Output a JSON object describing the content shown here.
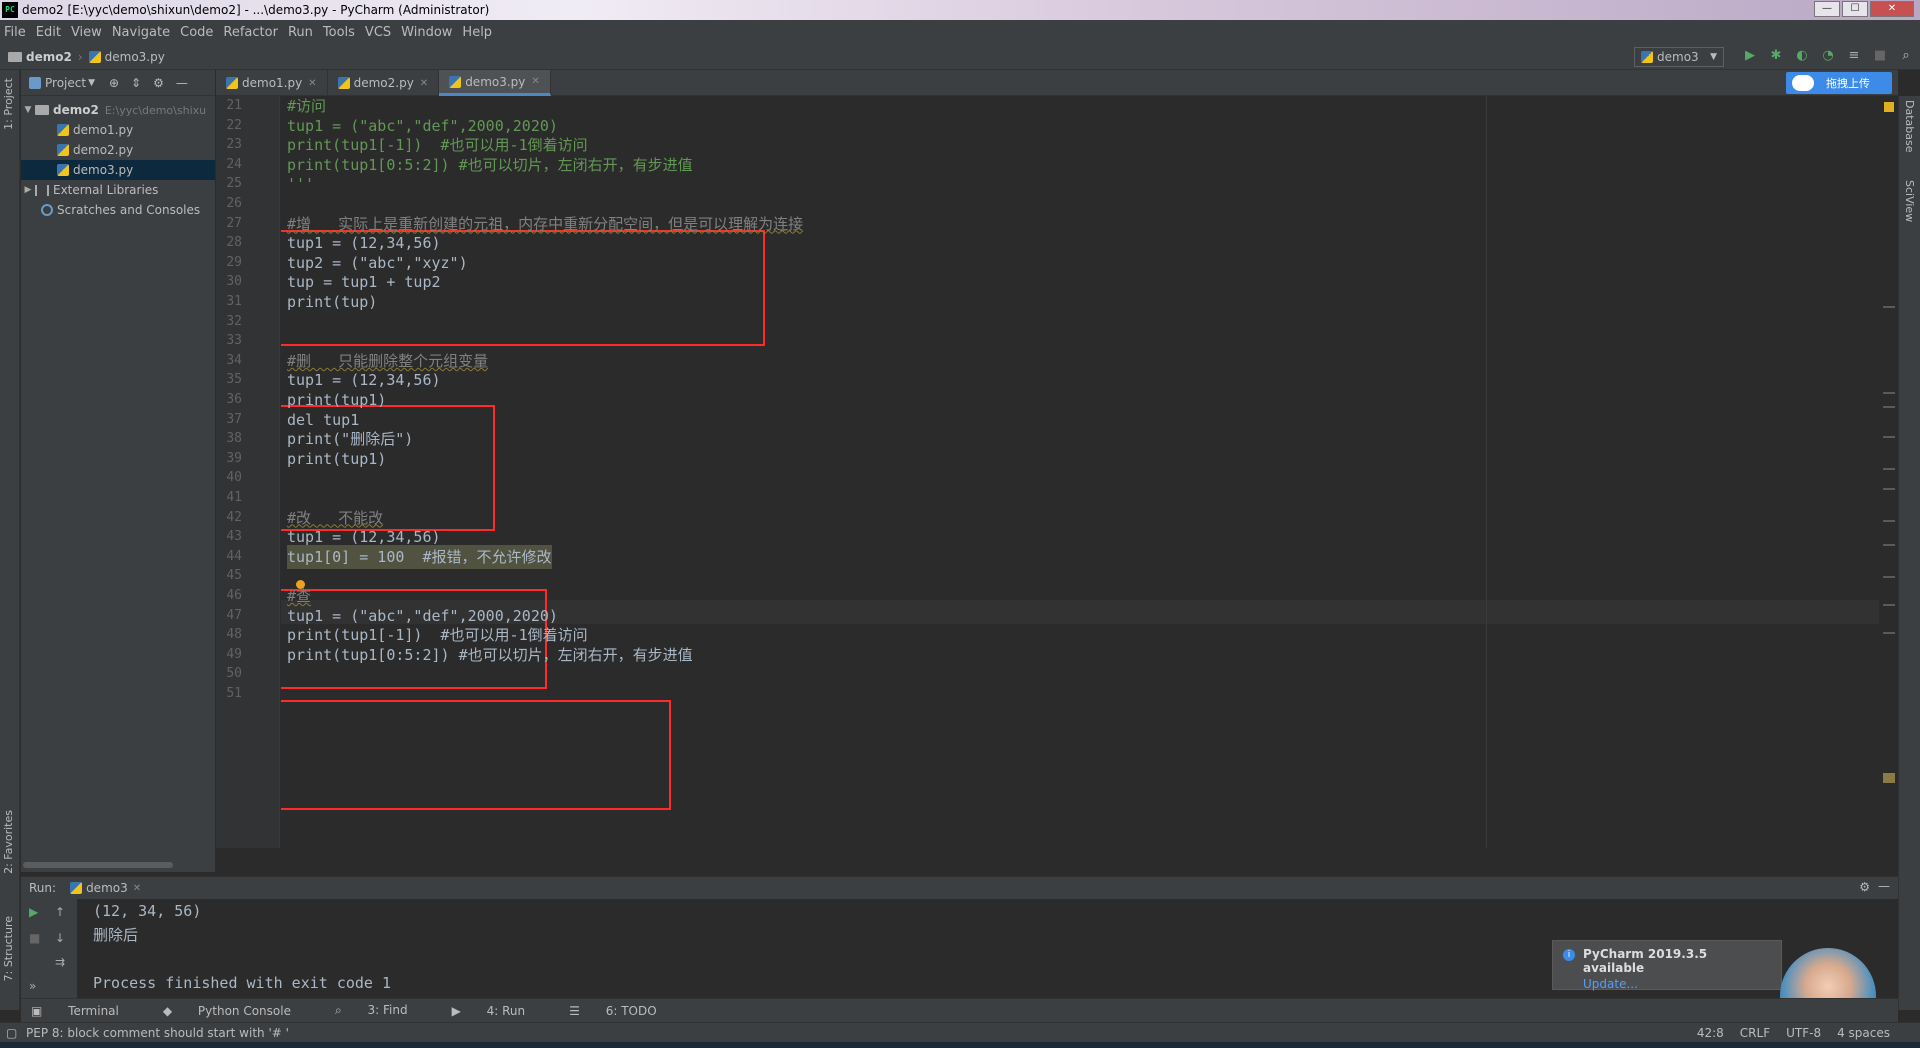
{
  "window": {
    "title": "demo2 [E:\\yyc\\demo\\shixun\\demo2] - ...\\demo3.py - PyCharm (Administrator)"
  },
  "menu": [
    "File",
    "Edit",
    "View",
    "Navigate",
    "Code",
    "Refactor",
    "Run",
    "Tools",
    "VCS",
    "Window",
    "Help"
  ],
  "breadcrumb": {
    "project": "demo2",
    "file": "demo3.py"
  },
  "run_config": "demo3",
  "project_panel": {
    "title": "Project",
    "vertical_tab": "1: Project",
    "root": {
      "name": "demo2",
      "path": "E:\\yyc\\demo\\shixu"
    },
    "files": [
      "demo1.py",
      "demo2.py",
      "demo3.py"
    ],
    "selected": "demo3.py",
    "external": "External Libraries",
    "scratches": "Scratches and Consoles"
  },
  "tabs": [
    "demo1.py",
    "demo2.py",
    "demo3.py"
  ],
  "active_tab": "demo3.py",
  "upload_button": "拖拽上传",
  "right_tools": [
    "Database",
    "SciView"
  ],
  "left_tools": [
    "2: Favorites",
    "7: Structure"
  ],
  "editor": {
    "lines": [
      {
        "n": "21",
        "code": "#访问",
        "cls": "dim"
      },
      {
        "n": "22",
        "code": "tup1 = (\"abc\",\"def\",2000,2020)",
        "cls": "dim"
      },
      {
        "n": "23",
        "code": "print(tup1[-1])  #也可以用-1倒着访问",
        "cls": "dim"
      },
      {
        "n": "24",
        "code": "print(tup1[0:5:2]) #也可以切片，左闭右开，有步进值",
        "cls": "dim"
      },
      {
        "n": "25",
        "code": "'''",
        "cls": "dim"
      },
      {
        "n": "26",
        "code": "",
        "cls": ""
      },
      {
        "n": "27",
        "code": "#增   实际上是重新创建的元祖，内存中重新分配空间，但是可以理解为连接",
        "cls": "comment warn"
      },
      {
        "n": "28",
        "code": "tup1 = (12,34,56)",
        "cls": ""
      },
      {
        "n": "29",
        "code": "tup2 = (\"abc\",\"xyz\")",
        "cls": ""
      },
      {
        "n": "30",
        "code": "tup = tup1 + tup2",
        "cls": ""
      },
      {
        "n": "31",
        "code": "print(tup)",
        "cls": ""
      },
      {
        "n": "32",
        "code": "",
        "cls": ""
      },
      {
        "n": "33",
        "code": "",
        "cls": ""
      },
      {
        "n": "34",
        "code": "#删   只能删除整个元组变量",
        "cls": "comment warn"
      },
      {
        "n": "35",
        "code": "tup1 = (12,34,56)",
        "cls": ""
      },
      {
        "n": "36",
        "code": "print(tup1)",
        "cls": ""
      },
      {
        "n": "37",
        "code": "del tup1",
        "cls": ""
      },
      {
        "n": "38",
        "code": "print(\"删除后\")",
        "cls": ""
      },
      {
        "n": "39",
        "code": "print(tup1)",
        "cls": ""
      },
      {
        "n": "40",
        "code": "",
        "cls": ""
      },
      {
        "n": "41",
        "code": "",
        "cls": ""
      },
      {
        "n": "42",
        "code": "#改   不能改",
        "cls": "comment warn"
      },
      {
        "n": "43",
        "code": "tup1 = (12,34,56)",
        "cls": ""
      },
      {
        "n": "44",
        "code": "tup1[0] = 100  #报错，不允许修改",
        "cls": "hl"
      },
      {
        "n": "45",
        "code": "",
        "cls": ""
      },
      {
        "n": "46",
        "code": "#查",
        "cls": "comment warn"
      },
      {
        "n": "47",
        "code": "tup1 = (\"abc\",\"def\",2000,2020)",
        "cls": ""
      },
      {
        "n": "48",
        "code": "print(tup1[-1])  #也可以用-1倒着访问",
        "cls": ""
      },
      {
        "n": "49",
        "code": "print(tup1[0:5:2]) #也可以切片，左闭右开，有步进值",
        "cls": ""
      },
      {
        "n": "50",
        "code": "",
        "cls": ""
      },
      {
        "n": "51",
        "code": "",
        "cls": ""
      }
    ]
  },
  "run_panel": {
    "label": "Run:",
    "tab": "demo3",
    "output": [
      "(12, 34, 56)",
      "删除后",
      "",
      "Process finished with exit code 1"
    ]
  },
  "notification": {
    "title": "PyCharm 2019.3.5 available",
    "link": "Update..."
  },
  "bottom_tabs": [
    "Terminal",
    "Python Console",
    "3: Find",
    "4: Run",
    "6: TODO"
  ],
  "status": {
    "message": "PEP 8: block comment should start with '# '",
    "position": "42:8",
    "line_sep": "CRLF",
    "encoding": "UTF-8",
    "indent": "4 spaces"
  }
}
